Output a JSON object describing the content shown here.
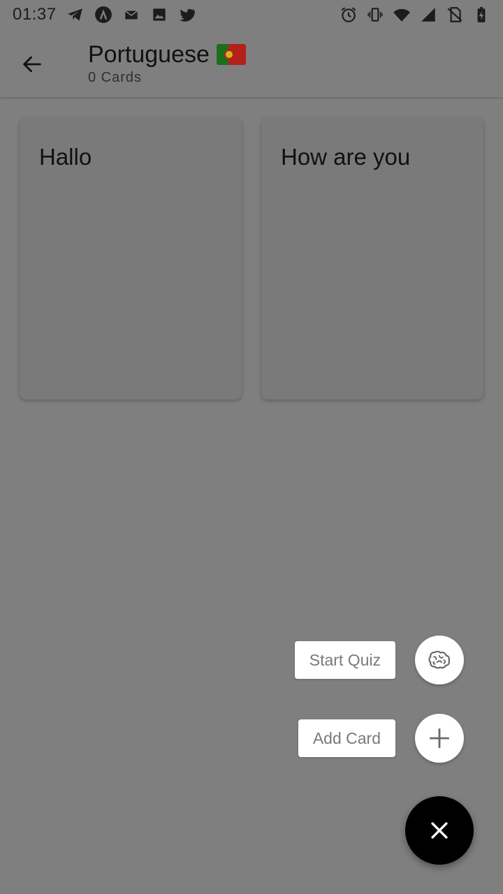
{
  "status_bar": {
    "time": "01:37",
    "left_icons": [
      "telegram-icon",
      "arch-icon",
      "mail-icon",
      "image-icon",
      "twitter-icon"
    ],
    "right_icons": [
      "alarm-icon",
      "vibrate-icon",
      "wifi-icon",
      "signal-icon",
      "no-sim-icon",
      "battery-charging-icon"
    ]
  },
  "app_bar": {
    "title": "Portuguese",
    "flag": "portugal-flag-icon",
    "subtitle": "0 Cards",
    "back_icon": "arrow-back-icon"
  },
  "cards": [
    {
      "text": "Hallo"
    },
    {
      "text": "How are you"
    }
  ],
  "fab_menu": {
    "quiz_label": "Start Quiz",
    "quiz_icon": "brain-icon",
    "add_label": "Add Card",
    "add_icon": "plus-icon",
    "main_icon": "close-icon"
  },
  "colors": {
    "scrim": "#7f7f7f",
    "fab_main": "#000000",
    "fab_mini": "#ffffff"
  }
}
